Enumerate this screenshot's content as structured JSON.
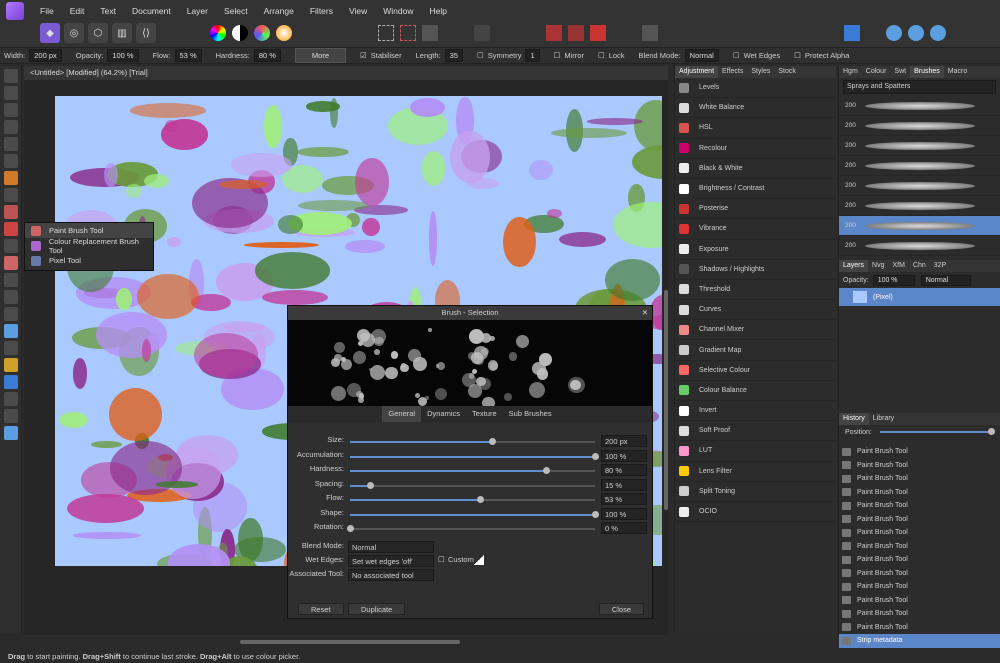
{
  "menu": [
    "File",
    "Edit",
    "Text",
    "Document",
    "Layer",
    "Select",
    "Arrange",
    "Filters",
    "View",
    "Window",
    "Help"
  ],
  "context": {
    "width_label": "Width:",
    "width": "200 px",
    "opacity_label": "Opacity:",
    "opacity": "100 %",
    "flow_label": "Flow:",
    "flow": "53 %",
    "hardness_label": "Hardness:",
    "hardness": "80 %",
    "more": "More",
    "stabiliser": "Stabiliser",
    "length_label": "Length:",
    "length": "35",
    "symmetry": "Symmetry",
    "symmetry_val": "1",
    "mirror": "Mirror",
    "lock": "Lock",
    "blend_label": "Blend Mode:",
    "blend": "Normal",
    "wet_edges": "Wet Edges",
    "protect_alpha": "Protect Alpha"
  },
  "doc_title": "<Untitled> [Modified] (64.2%) [Trial]",
  "flyout": [
    {
      "label": "Paint Brush Tool"
    },
    {
      "label": "Colour Replacement Brush Tool"
    },
    {
      "label": "Pixel Tool"
    }
  ],
  "dialog": {
    "title": "Brush - Selection",
    "tabs": [
      "General",
      "Dynamics",
      "Texture",
      "Sub Brushes"
    ],
    "rows": [
      {
        "label": "Size:",
        "value": "200 px",
        "fill": 0.58
      },
      {
        "label": "Accumulation:",
        "value": "100 %",
        "fill": 1.0
      },
      {
        "label": "Hardness:",
        "value": "80 %",
        "fill": 0.8
      },
      {
        "label": "Spacing:",
        "value": "15 %",
        "fill": 0.08
      },
      {
        "label": "Flow:",
        "value": "53 %",
        "fill": 0.53
      },
      {
        "label": "Shape:",
        "value": "100 %",
        "fill": 1.0
      },
      {
        "label": "Rotation:",
        "value": "0 %",
        "fill": 0.0
      }
    ],
    "blend_label": "Blend Mode:",
    "blend": "Normal",
    "wet_label": "Wet Edges:",
    "wet": "Set wet edges 'off'",
    "custom": "Custom",
    "assoc_label": "Associated Tool:",
    "assoc": "No associated tool",
    "reset": "Reset",
    "duplicate": "Duplicate",
    "close": "Close"
  },
  "adjustment": {
    "tabs": [
      "Adjustment",
      "Effects",
      "Styles",
      "Stock"
    ],
    "items": [
      "Levels",
      "White Balance",
      "HSL",
      "Recolour",
      "Black & White",
      "Brightness / Contrast",
      "Posterise",
      "Vibrance",
      "Exposure",
      "Shadows / Highlights",
      "Threshold",
      "Curves",
      "Channel Mixer",
      "Gradient Map",
      "Selective Colour",
      "Colour Balance",
      "Invert",
      "Soft Proof",
      "LUT",
      "Lens Filter",
      "Split Toning",
      "OCIO"
    ],
    "colors": [
      "#888",
      "#ddd",
      "#d9534f",
      "#c06",
      "#eee",
      "#fff",
      "#c33",
      "#d33",
      "#eee",
      "#555",
      "#ddd",
      "#ddd",
      "#e88",
      "#ccc",
      "#f66",
      "#6c6",
      "#fff",
      "#ddd",
      "#f9c",
      "#fc0",
      "#ccc",
      "#eee"
    ]
  },
  "brushes": {
    "tabs": [
      "Hgm",
      "Colour",
      "Swt",
      "Brushes",
      "Macro"
    ],
    "category": "Sprays and Spatters",
    "sizes": [
      "200",
      "200",
      "200",
      "200",
      "200",
      "200",
      "200",
      "200"
    ]
  },
  "layers": {
    "tabs": [
      "Layers",
      "Nvg",
      "XfM",
      "Chn",
      "32P"
    ],
    "opacity_label": "Opacity:",
    "opacity": "100 %",
    "blend": "Normal",
    "layer_name": "(Pixel)"
  },
  "history": {
    "tabs": [
      "History",
      "Library"
    ],
    "position_label": "Position:",
    "items": [
      "Paint Brush Tool",
      "Paint Brush Tool",
      "Paint Brush Tool",
      "Paint Brush Tool",
      "Paint Brush Tool",
      "Paint Brush Tool",
      "Paint Brush Tool",
      "Paint Brush Tool",
      "Paint Brush Tool",
      "Paint Brush Tool",
      "Paint Brush Tool",
      "Paint Brush Tool",
      "Paint Brush Tool",
      "Paint Brush Tool",
      "Strip metadata"
    ]
  },
  "status": {
    "p1": "Drag",
    "p2": " to start painting. ",
    "p3": "Drag+Shift",
    "p4": " to continue last stroke. ",
    "p5": "Drag+Alt",
    "p6": " to use colour picker."
  }
}
